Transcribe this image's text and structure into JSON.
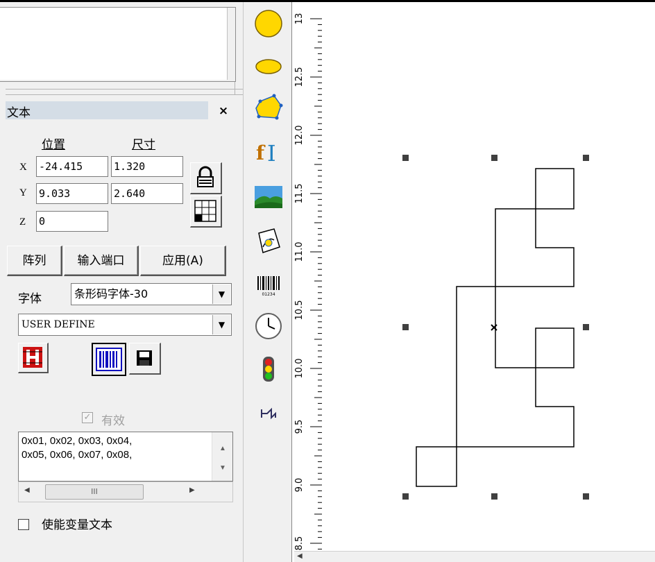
{
  "panel": {
    "title": "文本",
    "close": "×",
    "position_header": "位置",
    "size_header": "尺寸",
    "x_label": "X",
    "y_label": "Y",
    "z_label": "Z",
    "x_value": "-24.415",
    "y_value": "9.033",
    "z_value": "0",
    "width_value": "1.320",
    "height_value": "2.640"
  },
  "buttons": {
    "array": "阵列",
    "input_port": "输入端口",
    "apply": "应用(A)"
  },
  "font": {
    "label": "字体",
    "selected": "条形码字体-30",
    "mode": "USER DEFINE"
  },
  "valid": {
    "label": "有效",
    "checked": true
  },
  "text_content": {
    "line1": "0x01, 0x02, 0x03, 0x04,",
    "line2": "0x05, 0x06, 0x07, 0x08,"
  },
  "hscroll_thumb": "III",
  "enable_var_text": {
    "label": "使能变量文本",
    "checked": false
  },
  "ruler": {
    "ticks": [
      "13",
      "12.5",
      "12.0",
      "11.5",
      "11.0",
      "10.5",
      "10.0",
      "9.5",
      "9.0",
      "8.5"
    ]
  },
  "toolbar": [
    "circle-tool",
    "ellipse-tool",
    "polygon-tool",
    "text-tool",
    "bitmap-tool",
    "vector-file-tool",
    "barcode-tool",
    "timer-tool",
    "io-tool",
    "delay-tool"
  ],
  "colors": {
    "accent_yellow": "#ffd700",
    "titlebar": "#d4dde6",
    "barcode_blue": "#1010c0",
    "red_icon": "#cc1111"
  }
}
